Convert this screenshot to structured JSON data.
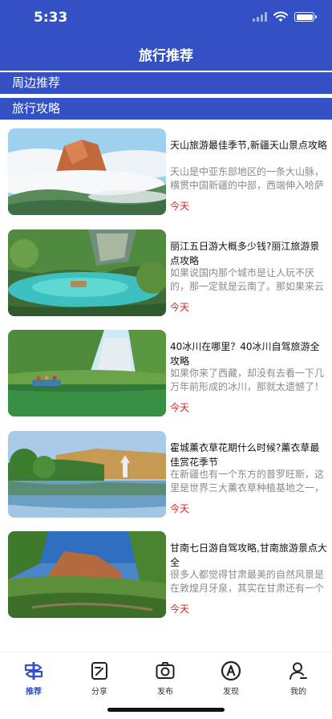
{
  "status": {
    "time": "5:33"
  },
  "nav": {
    "title": "旅行推荐"
  },
  "sections": [
    {
      "label": "周边推荐"
    },
    {
      "label": "旅行攻略"
    }
  ],
  "articles": [
    {
      "title": "天山旅游最佳季节,新疆天山景点攻略",
      "desc": "天山是中亚东部地区的一条大山脉，横贯中国新疆的中部，西端伸入哈萨克斯坦",
      "date": "今天"
    },
    {
      "title": "丽江五日游大概多少钱?丽江旅游景点攻略",
      "desc": "如果说国内那个城市是让人玩不厌的，那一定就是云南了。那如果来云南旅游",
      "date": "今天"
    },
    {
      "title": "40冰川在哪里？40冰川自驾旅游全攻略",
      "desc": "如果你来了西藏，却没有去看一下几万年前形成的冰川，那就太遗憾了！",
      "date": "今天"
    },
    {
      "title": "霍城薰衣草花期什么时候?薰衣草最佳赏花季节",
      "desc": "在新疆也有一个东方的普罗旺斯，这里是世界三大薰衣草种植基地之一，",
      "date": "今天"
    },
    {
      "title": "甘南七日游自驾攻略,甘南旅游景点大全",
      "desc": "很多人都觉得甘肃最美的自然风景是在敦煌月牙泉，其实在甘肃还有一个",
      "date": "今天"
    }
  ],
  "tabbar": [
    {
      "label": "推荐",
      "icon": "signpost-icon",
      "active": true
    },
    {
      "label": "分享",
      "icon": "edit-note-icon"
    },
    {
      "label": "发布",
      "icon": "camera-icon"
    },
    {
      "label": "发现",
      "icon": "compass-a-icon"
    },
    {
      "label": "我的",
      "icon": "user-icon"
    }
  ],
  "colors": {
    "brand": "#3350c4",
    "date": "#e02020",
    "desc": "#8a8a8a"
  }
}
